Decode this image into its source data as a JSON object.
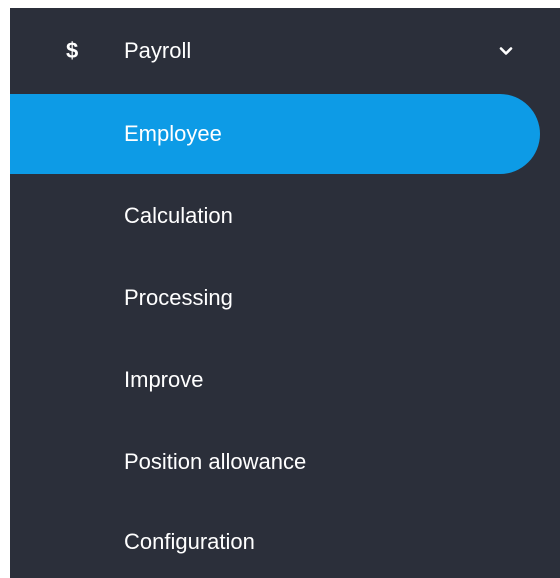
{
  "menu": {
    "header": {
      "icon": "dollar-icon",
      "icon_glyph": "$",
      "label": "Payroll",
      "expand_icon": "chevron-down-icon"
    },
    "active_color": "#0d9be6",
    "background_color": "#2b2f3a",
    "items": [
      {
        "label": "Employee",
        "active": true
      },
      {
        "label": "Calculation",
        "active": false
      },
      {
        "label": "Processing",
        "active": false
      },
      {
        "label": "Improve",
        "active": false
      },
      {
        "label": "Position allowance",
        "active": false
      },
      {
        "label": "Configuration",
        "active": false
      }
    ]
  }
}
